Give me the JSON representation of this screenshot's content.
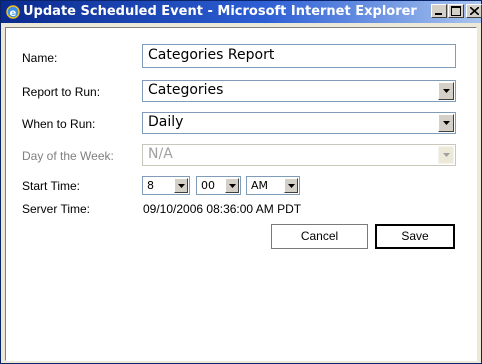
{
  "window": {
    "title": "Update Scheduled Event - Microsoft Internet Explorer",
    "icon": "ie-icon"
  },
  "form": {
    "name": {
      "label": "Name:",
      "value": "Categories Report"
    },
    "report": {
      "label": "Report to Run:",
      "value": "Categories"
    },
    "when": {
      "label": "When to Run:",
      "value": "Daily"
    },
    "day": {
      "label": "Day of the Week:",
      "value": "N/A",
      "disabled": true
    },
    "start_time": {
      "label": "Start Time:",
      "hour": "8",
      "minute": "00",
      "ampm": "AM"
    },
    "server_time": {
      "label": "Server Time:",
      "value": "09/10/2006 08:36:00 AM PDT"
    }
  },
  "buttons": {
    "cancel": "Cancel",
    "save": "Save"
  },
  "colors": {
    "title_start": "#0a2a8e",
    "title_end": "#a8c4ef",
    "field_border": "#7f9db9"
  }
}
